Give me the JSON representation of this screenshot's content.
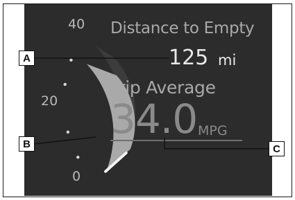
{
  "gauge": {
    "scale_top": "40",
    "scale_mid": "20",
    "scale_bottom": "0",
    "fill_fraction": 0.85
  },
  "distance_to_empty": {
    "label": "Distance to Empty",
    "value": "125",
    "unit": "mi"
  },
  "trip_average": {
    "label": "Trip Average",
    "value": "34.0",
    "unit": "MPG"
  },
  "callouts": {
    "a": "A",
    "b": "B",
    "c": "C"
  }
}
